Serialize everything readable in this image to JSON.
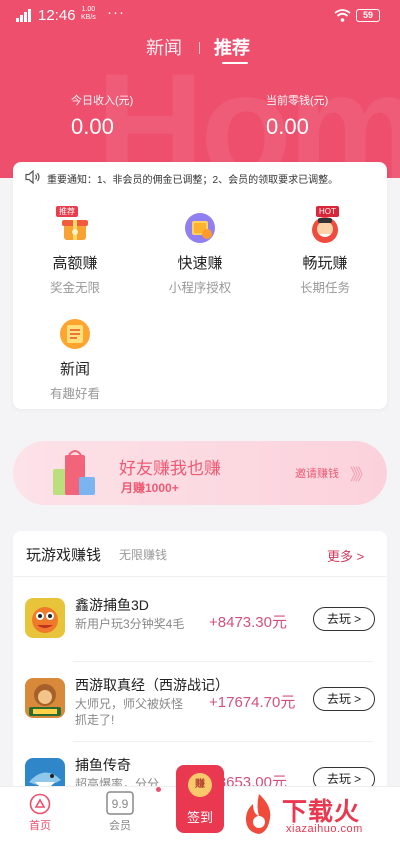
{
  "status_bar": {
    "signal": "4G",
    "time": "12:46",
    "speed_value": "1.00",
    "speed_unit": "KB/s",
    "dots": "···",
    "battery": "59"
  },
  "header": {
    "watermark": "Hom",
    "tabs": [
      {
        "label": "新闻"
      },
      {
        "label": "推荐"
      }
    ],
    "active_tab": "推荐",
    "income_today_label": "今日收入(元)",
    "income_today_value": "0.00",
    "change_label": "当前零钱(元)",
    "change_value": "0.00"
  },
  "notice": {
    "text": "重要通知：1、非会员的佣金已调整；2、会员的领取要求已调整。"
  },
  "features": [
    {
      "title": "高额赚",
      "sub": "奖金无限",
      "badge": "推荐",
      "icon": "gift-box-icon"
    },
    {
      "title": "快速赚",
      "sub": "小程序授权",
      "badge": "",
      "icon": "coin-stack-icon"
    },
    {
      "title": "畅玩赚",
      "sub": "长期任务",
      "badge": "HOT",
      "icon": "fortune-god-icon"
    },
    {
      "title": "新闻",
      "sub": "有趣好看",
      "badge": "",
      "icon": "news-icon"
    }
  ],
  "banner": {
    "title": "好友赚我也赚",
    "sub": "月赚1000+",
    "invite": "邀请赚钱",
    "arrow": "》》"
  },
  "games_section": {
    "title": "玩游戏赚钱",
    "sub": "无限赚钱",
    "more": "更多 >",
    "items": [
      {
        "name": "鑫游捕鱼3D",
        "desc": "新用户玩3分钟奖4毛",
        "reward": "+8473.30元",
        "button": "去玩 >",
        "icon": "fish-game-icon"
      },
      {
        "name": "西游取真经（西游战记）",
        "desc": "大师兄，师父被妖怪抓走了!",
        "reward": "+17674.70元",
        "button": "去玩 >",
        "icon": "monkey-king-icon"
      },
      {
        "name": "捕鱼传奇",
        "desc": "超高爆率，分分",
        "reward": "+8653.00元",
        "button": "去玩 >",
        "icon": "shark-game-icon"
      }
    ]
  },
  "bottom_nav": {
    "home": "首页",
    "member": "会员",
    "signin_coin": "赚",
    "signin": "签到"
  },
  "site_logo": {
    "text": "下载火",
    "url": "xiazaihuo.com"
  },
  "colors": {
    "primary": "#ee4f6c",
    "reward": "#d4507c",
    "more": "#d13a5c"
  }
}
